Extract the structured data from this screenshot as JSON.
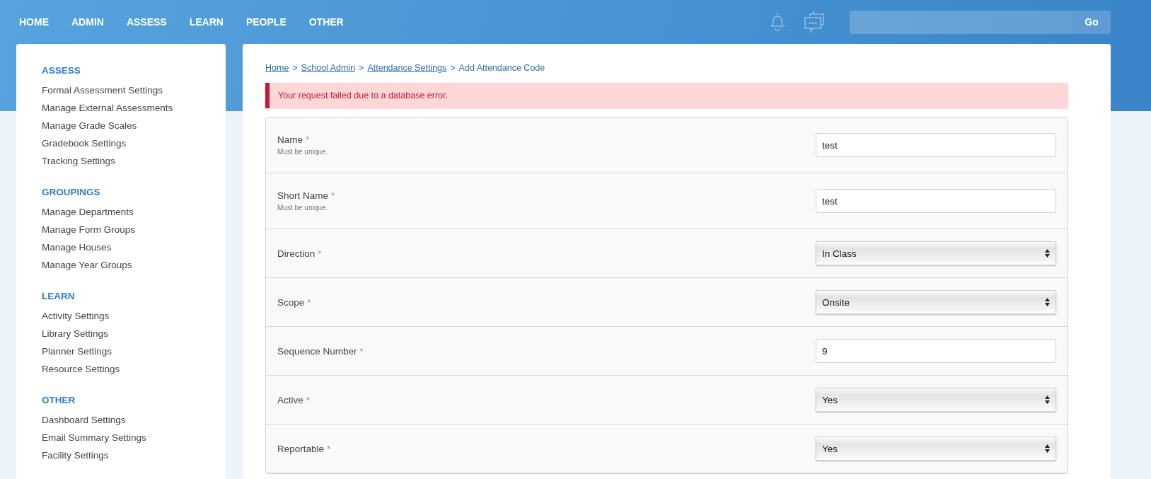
{
  "nav": {
    "items": [
      "HOME",
      "ADMIN",
      "ASSESS",
      "LEARN",
      "PEOPLE",
      "OTHER"
    ],
    "search": {
      "button": "Go"
    }
  },
  "sidebar": {
    "sections": [
      {
        "heading": "ASSESS",
        "items": [
          "Formal Assessment Settings",
          "Manage External Assessments",
          "Manage Grade Scales",
          "Gradebook Settings",
          "Tracking Settings"
        ]
      },
      {
        "heading": "GROUPINGS",
        "items": [
          "Manage Departments",
          "Manage Form Groups",
          "Manage Houses",
          "Manage Year Groups"
        ]
      },
      {
        "heading": "LEARN",
        "items": [
          "Activity Settings",
          "Library Settings",
          "Planner Settings",
          "Resource Settings"
        ]
      },
      {
        "heading": "OTHER",
        "items": [
          "Dashboard Settings",
          "Email Summary Settings",
          "Facility Settings"
        ]
      }
    ]
  },
  "breadcrumbs": [
    {
      "label": "Home",
      "kind": "link"
    },
    {
      "label": "School Admin",
      "kind": "link"
    },
    {
      "label": "Attendance Settings",
      "kind": "link"
    },
    {
      "label": "Add Attendance Code",
      "kind": "current"
    }
  ],
  "separator": ">",
  "error": "Your request failed due to a database error.",
  "form": {
    "rows": [
      {
        "label": "Name",
        "required": "*",
        "hint": "Must be unique.",
        "kind": "text",
        "value": "test"
      },
      {
        "label": "Short Name",
        "required": "*",
        "hint": "Must be unique.",
        "kind": "text",
        "value": "test"
      },
      {
        "label": "Direction",
        "required": "*",
        "kind": "select",
        "value": "In Class"
      },
      {
        "label": "Scope",
        "required": "*",
        "kind": "select",
        "value": "Onsite"
      },
      {
        "label": "Sequence Number",
        "required": "*",
        "kind": "text",
        "value": "9"
      },
      {
        "label": "Active",
        "required": "*",
        "kind": "select",
        "value": "Yes"
      },
      {
        "label": "Reportable",
        "required": "*",
        "kind": "select",
        "value": "Yes"
      }
    ]
  }
}
